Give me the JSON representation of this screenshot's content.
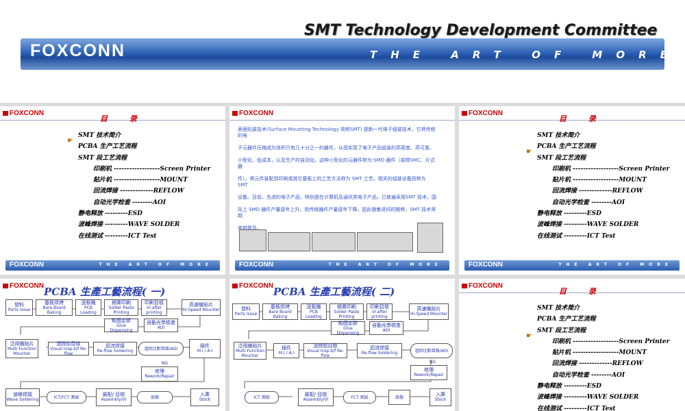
{
  "header": {
    "title": "SMT Technology Development Committee",
    "logo": "FOXCONN",
    "tagline": "THE ART OF MORE"
  },
  "slide_common": {
    "logo": "FOXCONN",
    "footer_logo": "FOXCONN",
    "footer_tagline": "THE ART OF MORE"
  },
  "toc": {
    "title": "目 录",
    "items": [
      "SMT 技术简介",
      "PCBA 生产工艺流程",
      "SMT 段工艺流程",
      "印刷机 ------------------Screen Printer",
      "贴片机 ------------------MOUNT",
      "回流焊接 -------------REFLOW",
      "自动光学检查 --------AOI",
      "静电释放 ---------ESD",
      "波峰焊接 ---------WAVE SOLDER",
      "在线测试 ---------ICT Test"
    ]
  },
  "intro": {
    "paragraphs": [
      "表面贴装技术(Surface Mounting Technology 简称SMT) 是新一代电子组装技术，它将传统的电",
      "子元器件压缩成为体积只有几十分之一的器件，从而实现了电子产品组装的高密度、高可靠、",
      "小型化、低成本，以及生产的自动化。这种小型化的元器件称为:SMD 器件（或称SMC、片式器",
      "件）。将元件装配到印刷或其它基板上的工艺方法称为 SMT 工艺。相关的组装设备则称为 SMT",
      "设备。目前，先进的电子产品，特别是在计算机及通讯类电子产品，已普遍采用SMT 技术。国",
      "际上 SMD 器件产量逐年上升，而传统器件产量逐年下降，因此随着进间的推移，SMT 技术将越",
      "来越普及。"
    ]
  },
  "flow1": {
    "title": "PCBA 生產工藝流程( 一)",
    "boxes": [
      "發料\nParts Issue",
      "基板烘烤\nBare Board Baking",
      "送板機\nPCB Loading",
      "錫膏印刷\nSolder Paste Printing",
      "印刷目檢\nVI.after printing",
      "高速機貼片\nHi-Speed Mounter",
      "點固定膠\nGlue Dispensing",
      "自動光學檢查\nAOI",
      "泛用機貼片\nMulti Function Mounter",
      "迴焊前目檢\nVisual Insp.b/f Re-flow",
      "迴流焊接\nRe-flow  Soldering",
      "迴后比對目檢/AOI",
      "插件\nM.I / A.I",
      "修理\nRework/Repair",
      "波峰焊接\nWave Soldering",
      "ICT/FCT 測試",
      "裝配/ 目檢\nAssembly/VI",
      "品檢",
      "入庫\nStock"
    ],
    "ng": "NG"
  },
  "flow2": {
    "title": "PCBA 生產工藝流程( 二)",
    "boxes": [
      "發料\nParts Issue",
      "基板烘烤\nBare Board Baking",
      "送板機\nPCB Loading",
      "錫膏印刷\nSolder Paste Printing",
      "印刷目檢\nVI.after printing",
      "高速機貼片\nHi-Speed Mounter",
      "點固定膠\nGlue Dispensing",
      "自動光學檢查\nAOI",
      "泛用機貼片\nMulti Function Mounter",
      "插件\nM.I / A.I",
      "迴焊前目檢\nVisual Insp.b/f Re-flow",
      "迴流焊接\nRe-flow  Soldering",
      "迴后比對目檢/AOI",
      "修理\nRework/Repair",
      "ICT 測試",
      "裝配/ 目檢\nAssembly/VI",
      "FCT 測試",
      "品檢",
      "入庫\nStock"
    ],
    "ng": "NG"
  }
}
